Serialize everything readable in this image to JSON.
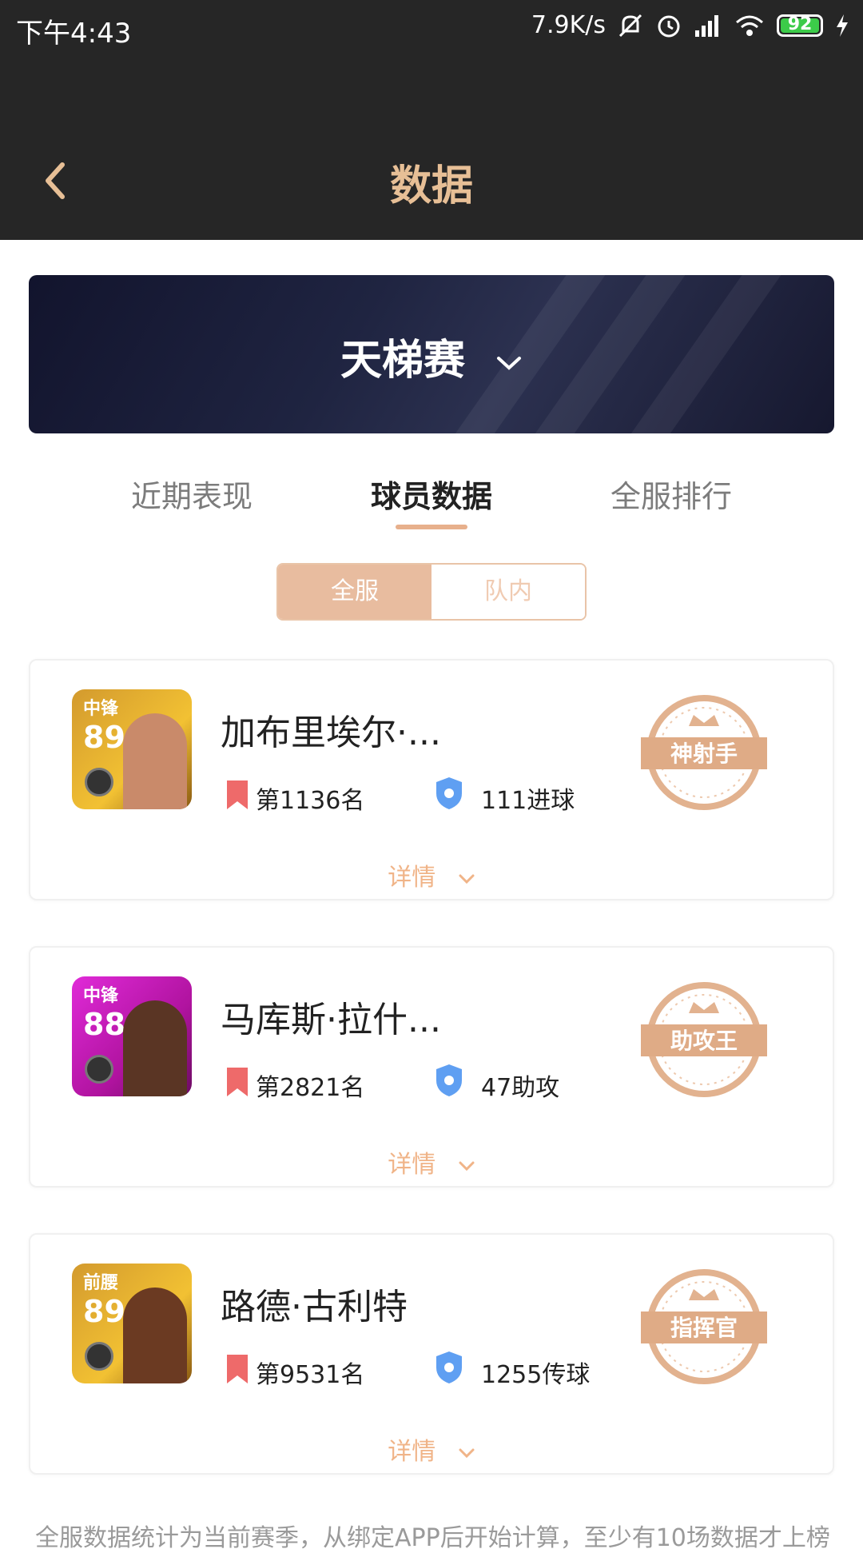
{
  "status_bar": {
    "time": "下午4:43",
    "speed": "7.9K/s",
    "battery": "92"
  },
  "header": {
    "title": "数据"
  },
  "banner": {
    "title": "天梯赛"
  },
  "tabs": [
    {
      "label": "近期表现"
    },
    {
      "label": "球员数据"
    },
    {
      "label": "全服排行"
    }
  ],
  "segment": {
    "options": [
      "全服",
      "队内"
    ],
    "selected": "全服"
  },
  "players": [
    {
      "position": "中锋",
      "rating": "89",
      "name": "加布里埃尔·...",
      "rank": "第1136名",
      "stat": "111进球",
      "badge": "神射手",
      "card_color": "#c98b22",
      "details": "详情"
    },
    {
      "position": "中锋",
      "rating": "88",
      "name": "马库斯·拉什...",
      "rank": "第2821名",
      "stat": "47助攻",
      "badge": "助攻王",
      "card_color": "#c21bbb",
      "details": "详情"
    },
    {
      "position": "前腰",
      "rating": "89",
      "name": "路德·古利特",
      "rank": "第9531名",
      "stat": "1255传球",
      "badge": "指挥官",
      "card_color": "#c98b22",
      "details": "详情"
    }
  ],
  "footnote": "全服数据统计为当前赛季，从绑定APP后开始计算，至少有10场数据才上榜",
  "colors": {
    "accent": "#e7bf96",
    "header_bg": "#262626",
    "rank_icon": "#ee6a6a",
    "stat_icon": "#5f9ff2"
  }
}
